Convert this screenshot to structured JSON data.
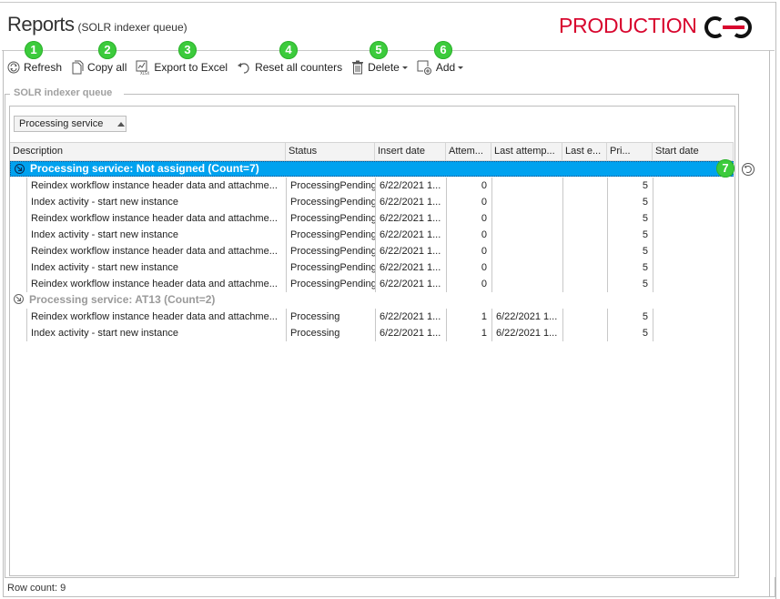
{
  "header": {
    "title": "Reports",
    "subtitle": "(SOLR indexer queue)",
    "environment": "PRODUCTION",
    "environment_color": "#d8062e"
  },
  "toolbar": {
    "items": [
      {
        "label": "Refresh",
        "icon": "refresh-icon",
        "badge": "1"
      },
      {
        "label": "Copy all",
        "icon": "copy-icon",
        "badge": "2"
      },
      {
        "label": "Export to Excel",
        "icon": "excel-export-icon",
        "badge": "3"
      },
      {
        "label": "Reset all counters",
        "icon": "undo-icon",
        "badge": "4"
      },
      {
        "label": "Delete",
        "icon": "trash-icon",
        "badge": "5",
        "dropdown": true
      },
      {
        "label": "Add",
        "icon": "add-icon",
        "badge": "6",
        "dropdown": true
      }
    ]
  },
  "panel": {
    "legend": "SOLR indexer queue",
    "group_by_chip": "Processing service",
    "side_badge": "7"
  },
  "grid": {
    "columns": [
      "Description",
      "Status",
      "Insert date",
      "Attem...",
      "Last attemp...",
      "Last e...",
      "Pri...",
      "Start date"
    ],
    "groups": [
      {
        "label": "Processing service: Not assigned (Count=7)",
        "selected": true,
        "rows": [
          {
            "description": "Reindex workflow instance header data and attachme...",
            "status": "ProcessingPending",
            "insert_date": "6/22/2021 1...",
            "attempts": "0",
            "last_attempt": "",
            "last_error": "",
            "priority": "5",
            "start_date": ""
          },
          {
            "description": "Index activity - start new instance",
            "status": "ProcessingPending",
            "insert_date": "6/22/2021 1...",
            "attempts": "0",
            "last_attempt": "",
            "last_error": "",
            "priority": "5",
            "start_date": ""
          },
          {
            "description": "Reindex workflow instance header data and attachme...",
            "status": "ProcessingPending",
            "insert_date": "6/22/2021 1...",
            "attempts": "0",
            "last_attempt": "",
            "last_error": "",
            "priority": "5",
            "start_date": ""
          },
          {
            "description": "Index activity - start new instance",
            "status": "ProcessingPending",
            "insert_date": "6/22/2021 1...",
            "attempts": "0",
            "last_attempt": "",
            "last_error": "",
            "priority": "5",
            "start_date": ""
          },
          {
            "description": "Reindex workflow instance header data and attachme...",
            "status": "ProcessingPending",
            "insert_date": "6/22/2021 1...",
            "attempts": "0",
            "last_attempt": "",
            "last_error": "",
            "priority": "5",
            "start_date": ""
          },
          {
            "description": "Index activity - start new instance",
            "status": "ProcessingPending",
            "insert_date": "6/22/2021 1...",
            "attempts": "0",
            "last_attempt": "",
            "last_error": "",
            "priority": "5",
            "start_date": ""
          },
          {
            "description": "Reindex workflow instance header data and attachme...",
            "status": "ProcessingPending",
            "insert_date": "6/22/2021 1...",
            "attempts": "0",
            "last_attempt": "",
            "last_error": "",
            "priority": "5",
            "start_date": ""
          }
        ]
      },
      {
        "label": "Processing service: AT13 (Count=2)",
        "selected": false,
        "rows": [
          {
            "description": "Reindex workflow instance header data and attachme...",
            "status": "Processing",
            "insert_date": "6/22/2021 1...",
            "attempts": "1",
            "last_attempt": "6/22/2021 1...",
            "last_error": "",
            "priority": "5",
            "start_date": ""
          },
          {
            "description": "Index activity - start new instance",
            "status": "Processing",
            "insert_date": "6/22/2021 1...",
            "attempts": "1",
            "last_attempt": "6/22/2021 1...",
            "last_error": "",
            "priority": "5",
            "start_date": ""
          }
        ]
      }
    ]
  },
  "footer": {
    "row_count": "Row count: 9"
  }
}
